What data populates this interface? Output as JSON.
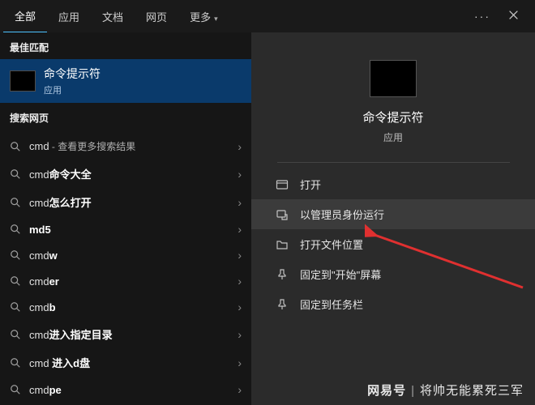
{
  "tabs": {
    "all": "全部",
    "apps": "应用",
    "docs": "文档",
    "web": "网页",
    "more": "更多"
  },
  "left": {
    "best_match_hdr": "最佳匹配",
    "best_match": {
      "title": "命令提示符",
      "sub": "应用"
    },
    "search_web_hdr": "搜索网页",
    "items": [
      {
        "prefix": "cmd",
        "bold": "",
        "suffix": " - 查看更多搜索结果"
      },
      {
        "prefix": "cmd",
        "bold": "命令大全",
        "suffix": ""
      },
      {
        "prefix": "cmd",
        "bold": "怎么打开",
        "suffix": ""
      },
      {
        "prefix": "",
        "bold": "md5",
        "suffix": ""
      },
      {
        "prefix": "cmd",
        "bold": "w",
        "suffix": ""
      },
      {
        "prefix": "cmd",
        "bold": "er",
        "suffix": ""
      },
      {
        "prefix": "cmd",
        "bold": "b",
        "suffix": ""
      },
      {
        "prefix": "cmd",
        "bold": "进入指定目录",
        "suffix": ""
      },
      {
        "prefix": "cmd ",
        "bold": "进入d盘",
        "suffix": ""
      },
      {
        "prefix": "cmd",
        "bold": "pe",
        "suffix": ""
      }
    ]
  },
  "right": {
    "title": "命令提示符",
    "sub": "应用",
    "actions": {
      "open": "打开",
      "run_admin": "以管理员身份运行",
      "open_loc": "打开文件位置",
      "pin_start": "固定到\"开始\"屏幕",
      "pin_taskbar": "固定到任务栏"
    }
  },
  "watermark": {
    "brand": "网易号",
    "text": "将帅无能累死三军"
  }
}
